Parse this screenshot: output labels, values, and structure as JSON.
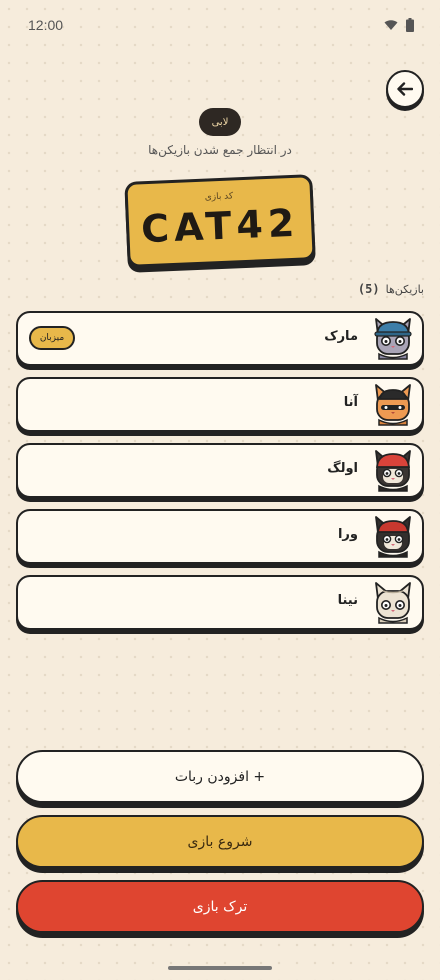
{
  "status_bar": {
    "time": "12:00"
  },
  "header": {
    "back_label": "←",
    "lobby_label": "لابی",
    "subtitle": "در انتظار جمع شدن بازیکن‌ها"
  },
  "code_card": {
    "label": "کد بازی",
    "code": "CAT42"
  },
  "players": {
    "heading": "بازیکن‌ها",
    "count": "(5)",
    "items": [
      {
        "name": "مارک",
        "badge": "میزبان",
        "avatar_icon": "cat-blue-cap-icon"
      },
      {
        "name": "آنا",
        "badge": "",
        "avatar_icon": "cat-orange-hat-icon"
      },
      {
        "name": "اولگ",
        "badge": "",
        "avatar_icon": "cat-red-hat-icon"
      },
      {
        "name": "ورا",
        "badge": "",
        "avatar_icon": "cat-dark-red-hat-icon"
      },
      {
        "name": "نینا",
        "badge": "",
        "avatar_icon": "cat-cream-icon"
      }
    ]
  },
  "actions": {
    "add_bot": "+ افزودن ربات",
    "start": "شروع بازی",
    "leave": "ترک بازی"
  },
  "colors": {
    "background": "#f6ecdc",
    "accent_yellow": "#e8b84a",
    "danger_red": "#df4530",
    "ink": "#222222"
  }
}
